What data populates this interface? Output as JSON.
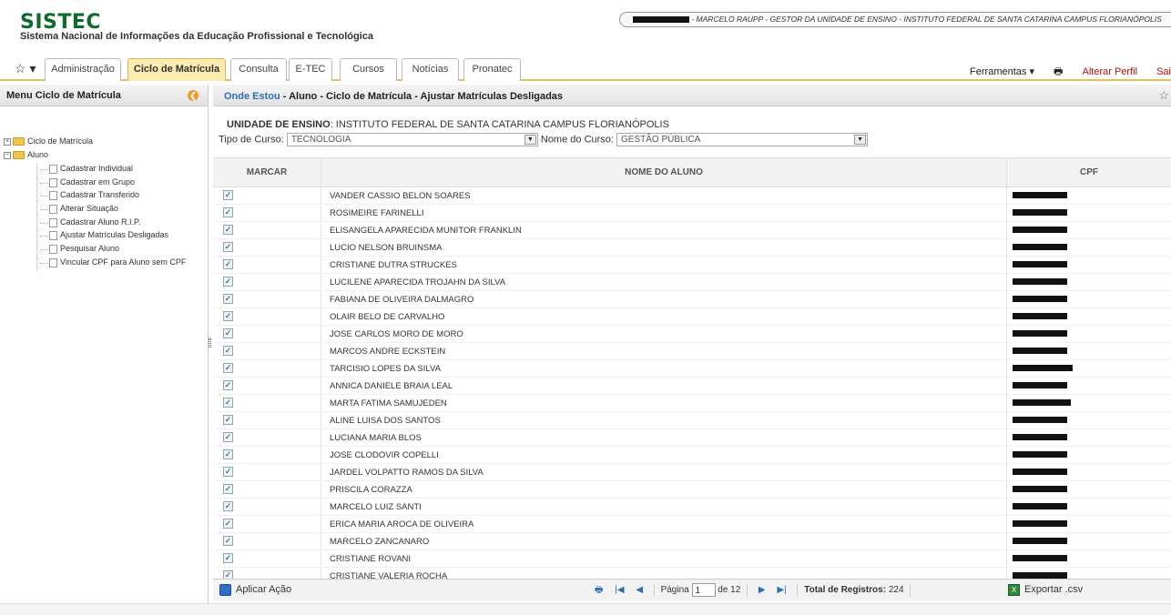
{
  "header": {
    "logo": "SISTEC",
    "subtitle": "Sistema Nacional de Informações da Educação Profissional e Tecnológica",
    "user_info": " - MARCELO RAUPP - GESTOR DA UNIDADE DE ENSINO - INSTITUTO FEDERAL DE SANTA CATARINA CAMPUS FLORIANÓPOLIS"
  },
  "tabs": [
    {
      "label": "Administração",
      "active": false
    },
    {
      "label": "Ciclo de Matrícula",
      "active": true
    },
    {
      "label": "Consulta",
      "active": false
    },
    {
      "label": "E-TEC",
      "active": false
    },
    {
      "label": "Cursos",
      "active": false
    },
    {
      "label": "Notícias",
      "active": false
    },
    {
      "label": "Pronatec",
      "active": false
    }
  ],
  "tools": {
    "ferramentas": "Ferramentas ▾",
    "alterar_perfil": "Alterar Perfil",
    "sair": "Sai"
  },
  "sidebar": {
    "title": "Menu Ciclo de Matrícula",
    "roots": [
      "Ciclo de Matrícula",
      "Aluno"
    ],
    "items": [
      "Cadastrar Individual",
      "Cadastrar em Grupo",
      "Cadastrar Transferido",
      "Alterar Situação",
      "Cadastrar Aluno R.I.P.",
      "Ajustar Matrículas Desligadas",
      "Pesquisar Aluno",
      "Vincular CPF para Aluno sem CPF"
    ]
  },
  "breadcrumb": {
    "lead": "Onde Estou",
    "path": " - Aluno - Ciclo de Matrícula - Ajustar Matrículas Desligadas"
  },
  "filters": {
    "unit_label": "UNIDADE DE ENSINO",
    "unit_value": ": INSTITUTO FEDERAL DE SANTA CATARINA CAMPUS FLORIANÓPOLIS",
    "tipo_label": "Tipo de Curso:",
    "tipo_value": "TECNOLOGIA",
    "nome_label": "Nome do Curso:",
    "nome_value": "GESTÃO PÚBLICA"
  },
  "grid": {
    "col_marcar": "MARCAR",
    "col_nome": "NOME DO ALUNO",
    "col_cpf": "CPF",
    "rows": [
      "VANDER CASSIO BELON SOARES",
      "ROSIMEIRE FARINELLI",
      "ELISANGELA APARECIDA MUNITOR FRANKLIN",
      "LUCIO NELSON BRUINSMA",
      "CRISTIANE DUTRA STRUCKES",
      "LUCILENE APARECIDA TROJAHN DA SILVA",
      "FABIANA DE OLIVEIRA DALMAGRO",
      "OLAIR BELO DE CARVALHO",
      "JOSE CARLOS MORO DE MORO",
      "MARCOS ANDRE ECKSTEIN",
      "TARCISIO LOPES DA SILVA",
      "ANNICA DANIELE BRAIA LEAL",
      "MARTA FATIMA SAMUJEDEN",
      "ALINE LUISA DOS SANTOS",
      "LUCIANA MARIA BLOS",
      "JOSE CLODOVIR COPELLI",
      "JARDEL VOLPATTO RAMOS DA SILVA",
      "PRISCILA CORAZZA",
      "MARCELO LUIZ SANTI",
      "ERICA MARIA AROCA DE OLIVEIRA",
      "MARCELO ZANCANARO",
      "CRISTIANE ROVANI",
      "CRISTIANE VALERIA ROCHA"
    ]
  },
  "pager": {
    "apply": "Aplicar Ação",
    "pagina": "Página",
    "page": "1",
    "de": "de 12",
    "total_label": "Total de Registros:",
    "total": " 224",
    "export": "Exportar .csv"
  },
  "icons": {
    "favorites": "star-icon",
    "print": "printer-icon",
    "collapse": "collapse-circle-icon"
  },
  "colors": {
    "brand_green": "#0e6b2c",
    "active_tab": "#fcecb0",
    "link_blue": "#2c6fb4",
    "red_link": "#b01010"
  }
}
